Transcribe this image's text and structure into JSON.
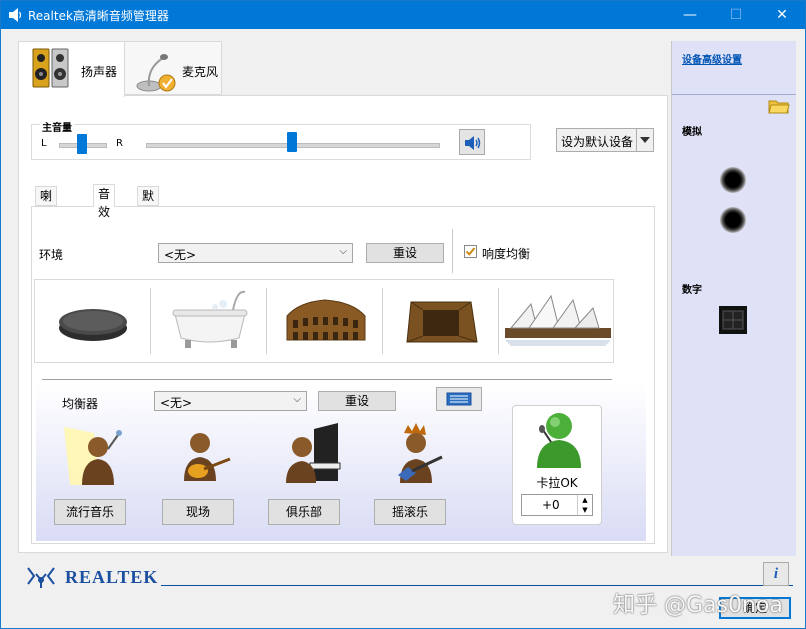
{
  "window": {
    "title": "Realtek高清晰音频管理器",
    "minimize_glyph": "—",
    "maximize_glyph": "☐",
    "close_glyph": "✕"
  },
  "device_tabs": [
    {
      "label": "扬声器",
      "icon": "speaker-icon",
      "active": true
    },
    {
      "label": "麦克风",
      "icon": "microphone-icon",
      "active": false
    }
  ],
  "volume": {
    "title": "主音量",
    "left_label": "L",
    "right_label": "R",
    "balance_fraction": 0.5,
    "level_fraction": 0.5
  },
  "default_device_button": "设为默认设备",
  "sub_tabs": [
    "喇叭组态",
    "音效",
    "默认格式"
  ],
  "environment": {
    "label": "环境",
    "selected": "<无>",
    "reset_label": "重设",
    "loudness_label": "响度均衡",
    "loudness_checked": true,
    "presets": [
      "stone-icon",
      "bathtub-icon",
      "colosseum-icon",
      "sewer-pipe-icon",
      "opera-house-icon"
    ]
  },
  "equalizer": {
    "label": "均衡器",
    "selected": "<无>",
    "reset_label": "重设",
    "presets": [
      "流行音乐",
      "现场",
      "俱乐部",
      "摇滚乐"
    ]
  },
  "karaoke": {
    "label": "卡拉OK",
    "value": "+0"
  },
  "right_panel": {
    "advanced_link": "设备高级设置",
    "analog_label": "模拟",
    "digital_label": "数字"
  },
  "brand": {
    "name": "REALTEK"
  },
  "info_button_glyph": "i",
  "ok_button": "确定",
  "watermark": "知乎 @Gas0noa",
  "colors": {
    "titlebar": "#0078d7",
    "slider_thumb": "#0078d7",
    "right_panel": "#dfe1f6",
    "brand": "#1b4fa0"
  }
}
